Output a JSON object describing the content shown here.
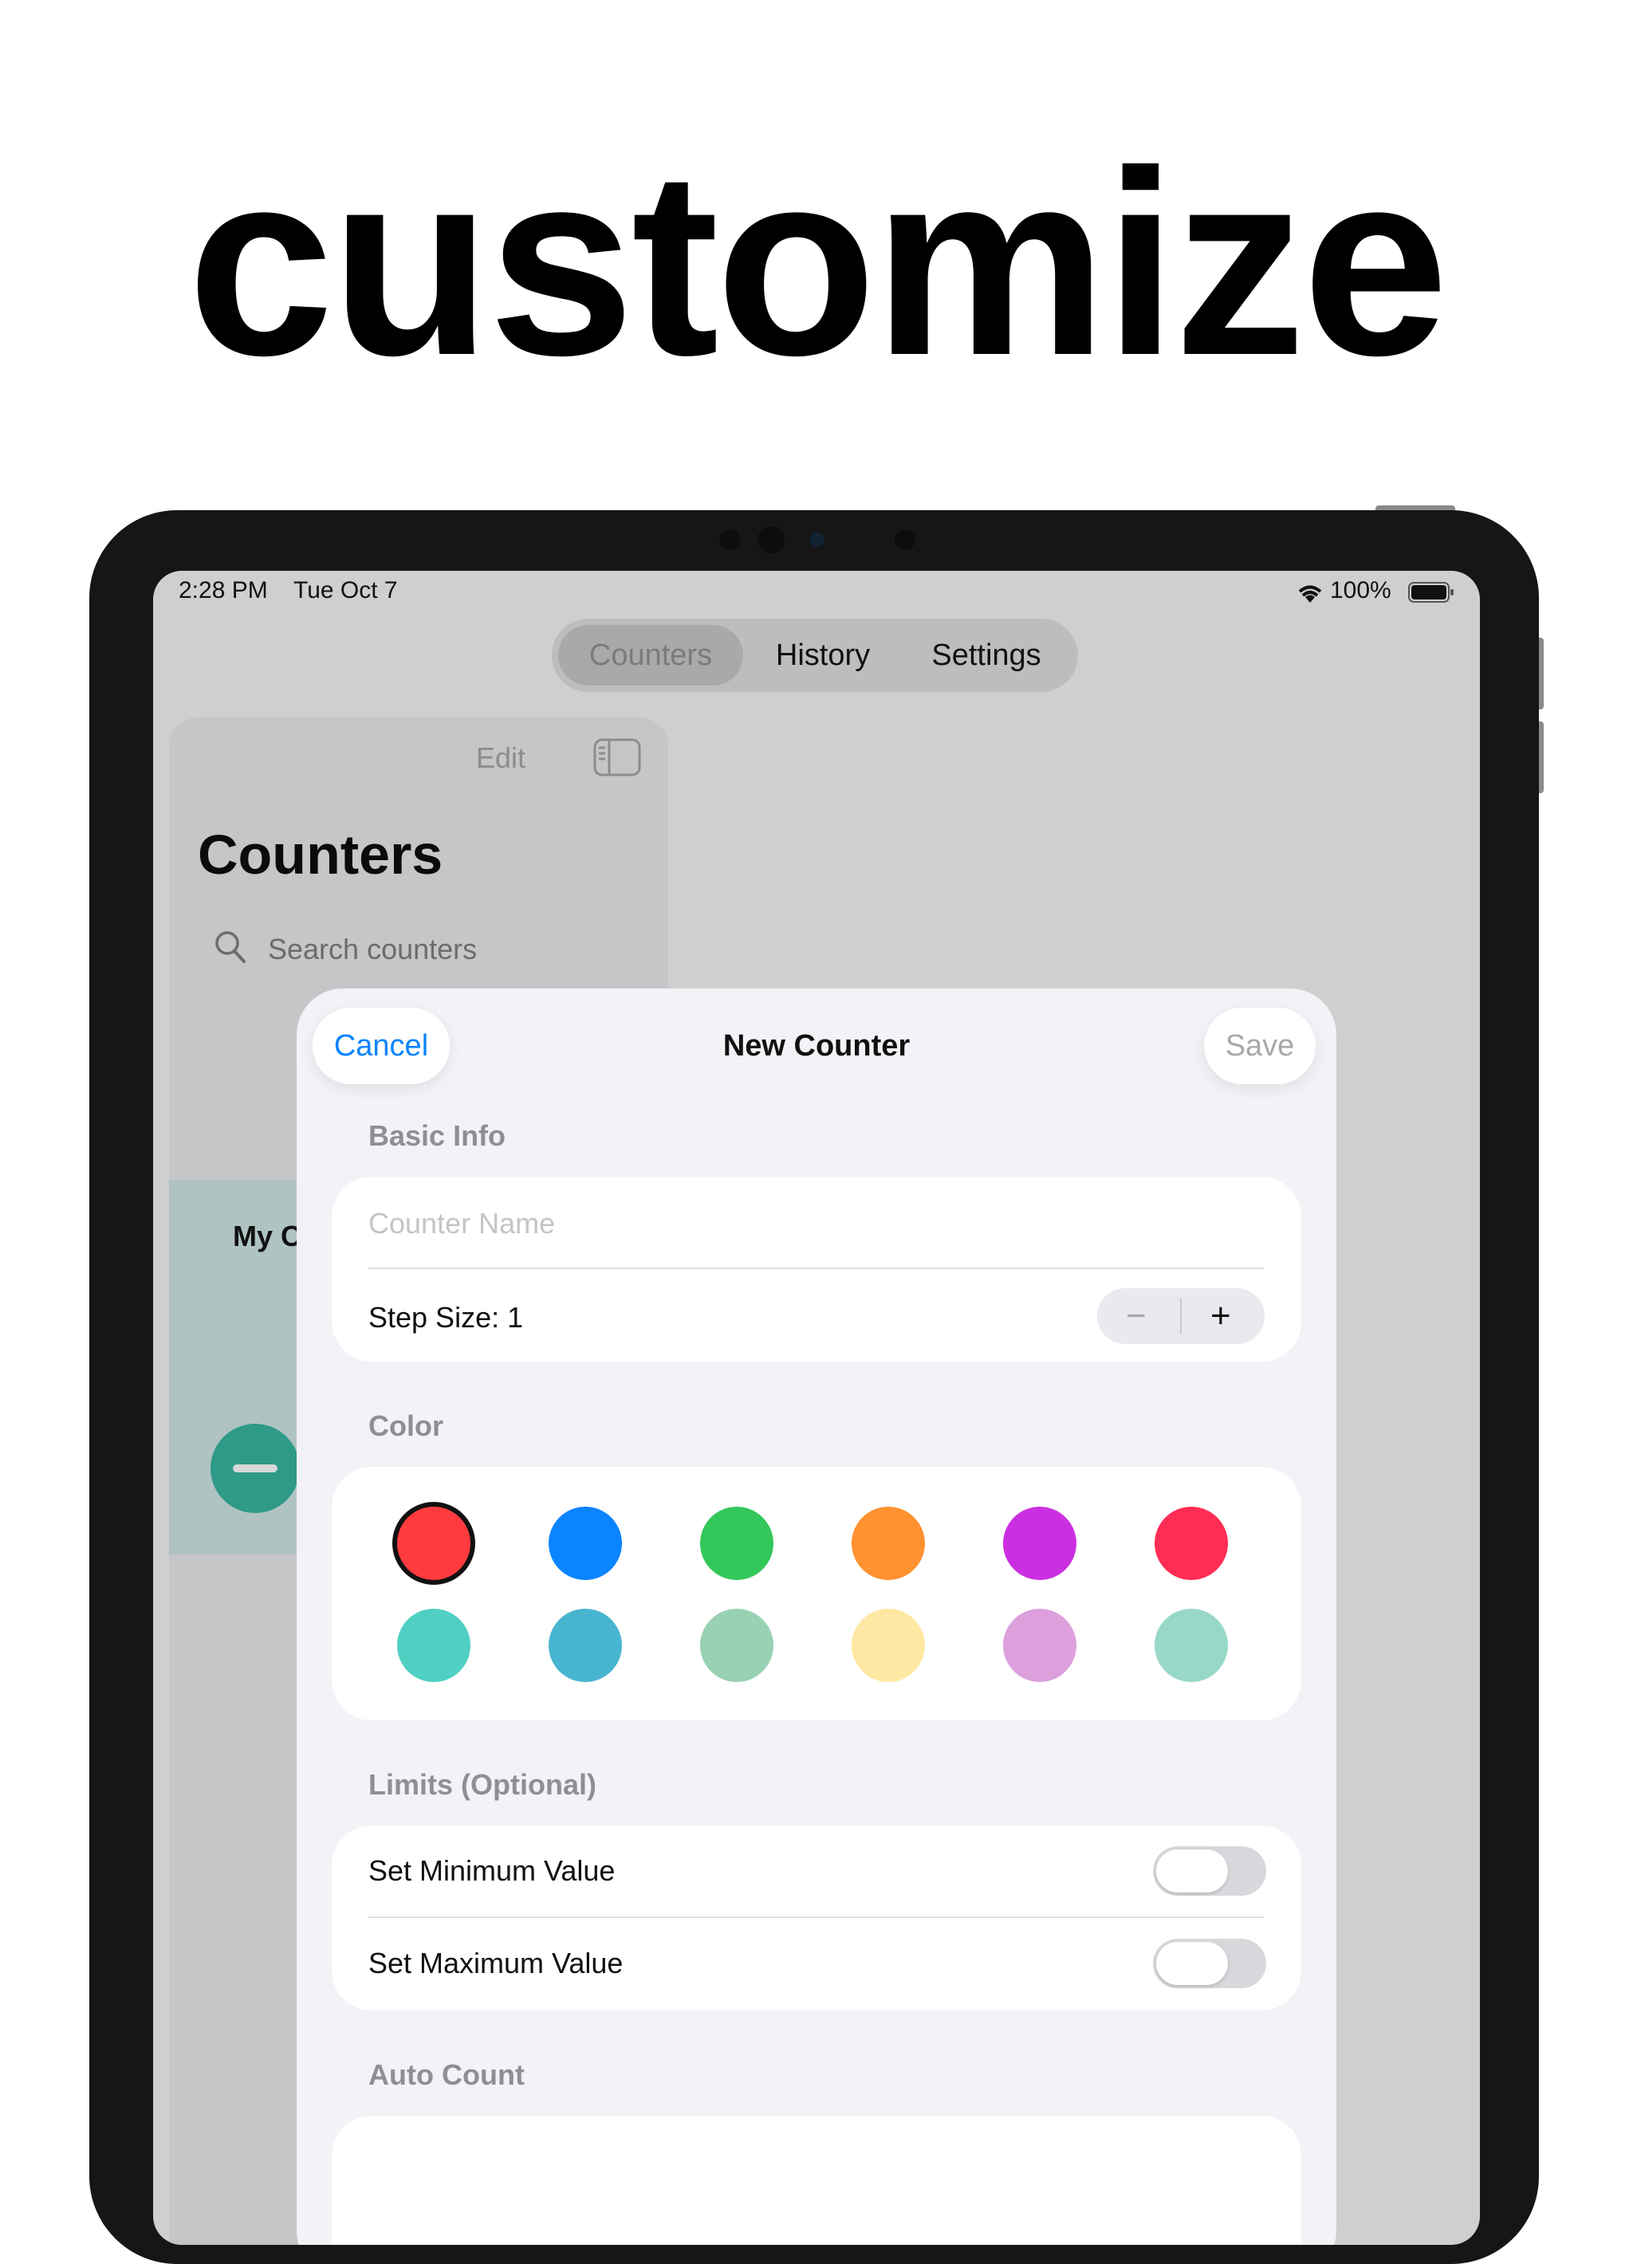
{
  "headline": "customize",
  "status_bar": {
    "time": "2:28 PM",
    "date": "Tue Oct 7",
    "battery": "100%"
  },
  "tabs": [
    {
      "label": "Counters",
      "selected": true
    },
    {
      "label": "History",
      "selected": false
    },
    {
      "label": "Settings",
      "selected": false
    }
  ],
  "sidebar": {
    "edit_label": "Edit",
    "title": "Counters",
    "search_placeholder": "Search counters",
    "card_title": "My C"
  },
  "sheet": {
    "cancel_label": "Cancel",
    "title": "New Counter",
    "save_label": "Save",
    "basic_info": {
      "header": "Basic Info",
      "name_placeholder": "Counter Name",
      "step_size_label": "Step Size: 1",
      "decrement_label": "−",
      "increment_label": "+"
    },
    "color": {
      "header": "Color",
      "swatches": [
        "#ff3b3f",
        "#0a84ff",
        "#34c759",
        "#ff9230",
        "#cb30e0",
        "#ff2d55",
        "#4fd0c3",
        "#48b5d0",
        "#99d1b3",
        "#ffe8a3",
        "#dda0dd",
        "#98d8c8"
      ],
      "selected_index": 0
    },
    "limits": {
      "header": "Limits (Optional)",
      "min_label": "Set Minimum Value",
      "max_label": "Set Maximum Value",
      "min_enabled": false,
      "max_enabled": false
    },
    "auto_count": {
      "header": "Auto Count"
    }
  },
  "colors": {
    "accent": "#0a84ff",
    "sheet_bg": "#f2f2f7",
    "dim_bg": "#cfcfcf"
  }
}
